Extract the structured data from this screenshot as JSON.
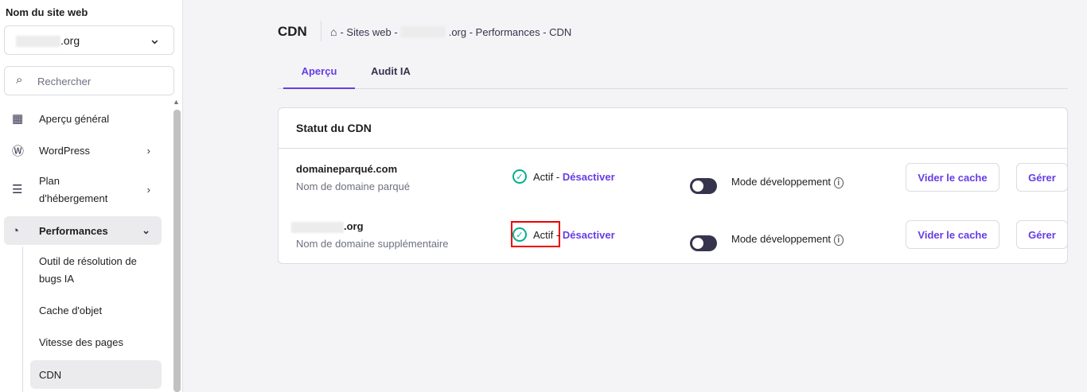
{
  "sidebar": {
    "label": "Nom du site web",
    "site": ".org",
    "search_placeholder": "Rechercher",
    "items": [
      {
        "label": "Aperçu général"
      },
      {
        "label": "WordPress"
      },
      {
        "label": "Plan d'hébergement"
      },
      {
        "label": "Performances"
      }
    ],
    "sub_items": [
      {
        "label": "Outil de résolution de bugs IA"
      },
      {
        "label": "Cache d'objet"
      },
      {
        "label": "Vitesse des pages"
      },
      {
        "label": "CDN"
      }
    ]
  },
  "header": {
    "title": "CDN",
    "breadcrumb_1": "- Sites web -",
    "breadcrumb_2": ".org - Performances - CDN"
  },
  "tabs": [
    {
      "label": "Aperçu"
    },
    {
      "label": "Audit IA"
    }
  ],
  "card": {
    "title": "Statut du CDN",
    "rows": [
      {
        "domain": "domaineparqué.com",
        "type": "Nom de domaine parqué",
        "status": "Actif",
        "action": "Désactiver",
        "dev_mode": "Mode développement",
        "clear": "Vider le cache",
        "manage": "Gérer"
      },
      {
        "domain": ".org",
        "type": "Nom de domaine supplémentaire",
        "status": "Actif",
        "action": "Désactiver",
        "dev_mode": "Mode développement",
        "clear": "Vider le cache",
        "manage": "Gérer"
      }
    ]
  }
}
